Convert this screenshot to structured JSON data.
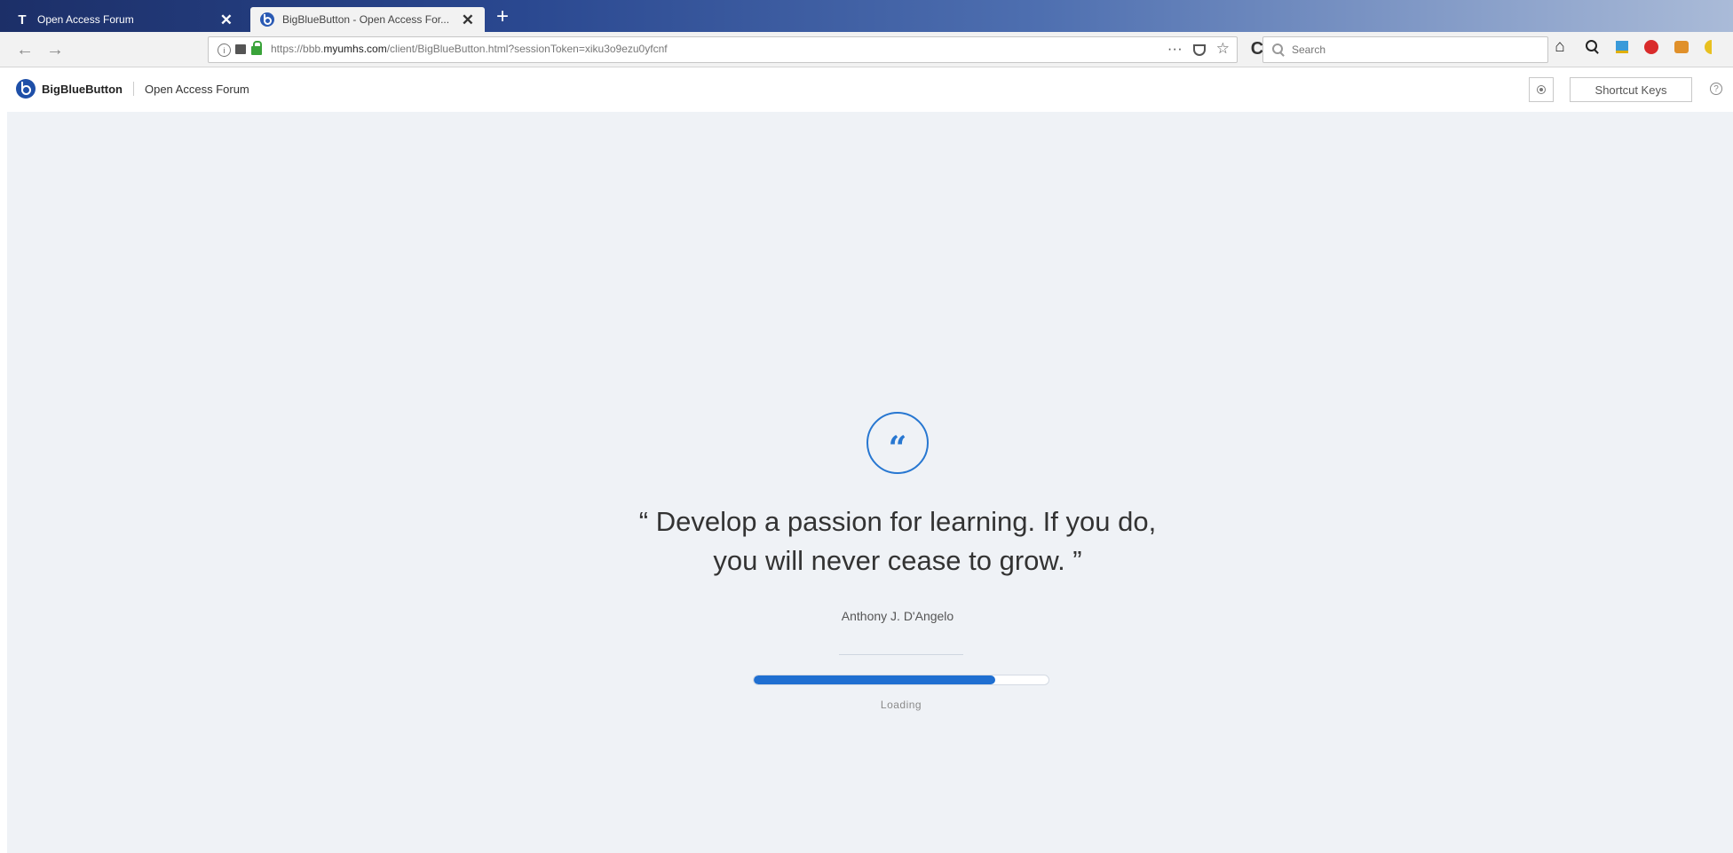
{
  "browser": {
    "tabs": [
      {
        "favicon": "T",
        "title": "Open Access Forum",
        "close": "✕"
      },
      {
        "favicon": "bigbluebutton-icon",
        "title": "BigBlueButton - Open Access For...",
        "close": "✕"
      }
    ],
    "new_tab": "+",
    "back": "←",
    "forward": "→",
    "url": {
      "scheme_prefix": "https://bbb.",
      "domain": "myumhs.com",
      "path": "/client/BigBlueButton.html?sessionToken=xiku3o9ezu0yfcnf"
    },
    "page_actions": "···",
    "bookmark_star": "☆",
    "reload": "C",
    "search_placeholder": "Search",
    "home_icon": "⌂"
  },
  "app": {
    "brand": "BigBlueButton",
    "meeting_name": "Open Access Forum",
    "shortcut_keys": "Shortcut Keys",
    "help": "?"
  },
  "loading": {
    "quote_glyph": "“",
    "quote": "“ Develop a passion for learning. If you do, you will never cease to grow. ”",
    "author": "Anthony J. D'Angelo",
    "progress_percent": 82,
    "label": "Loading",
    "accent_color": "#1f6fd1"
  }
}
